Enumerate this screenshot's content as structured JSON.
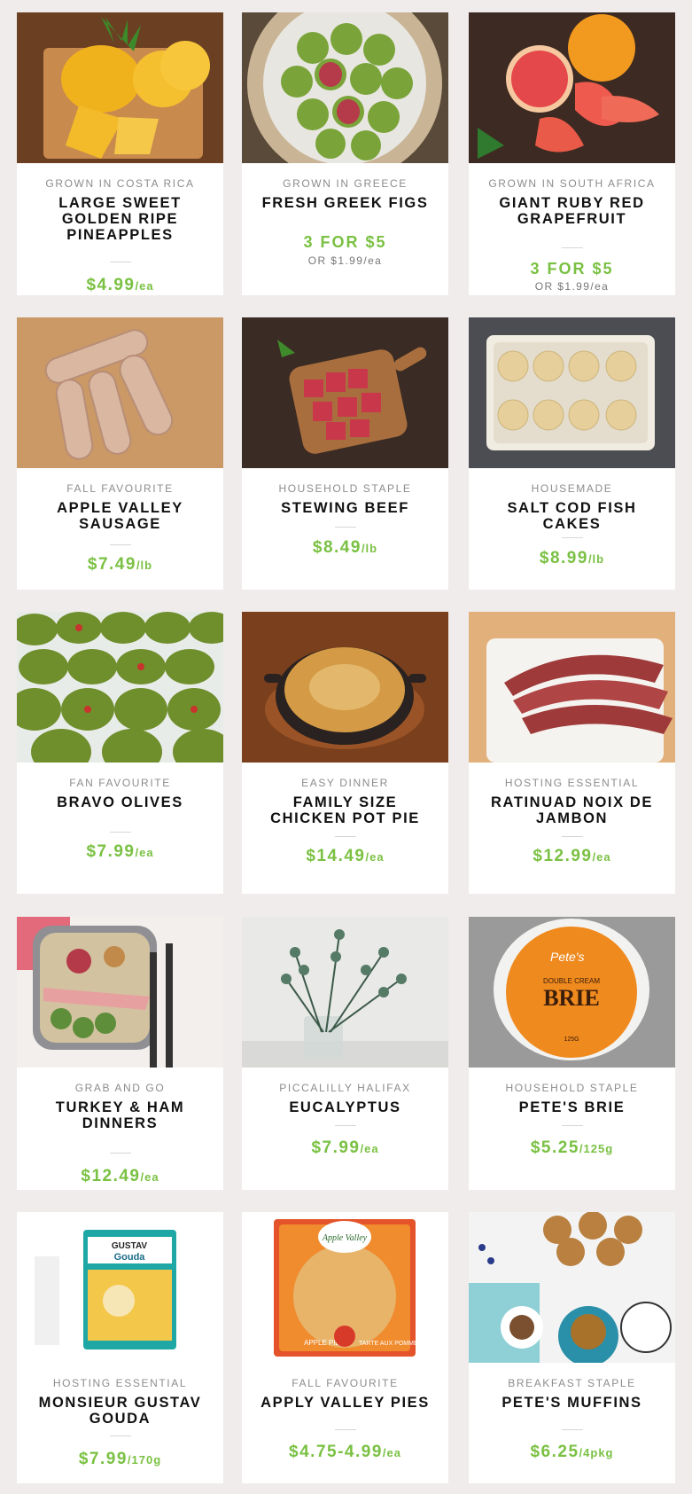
{
  "products": [
    {
      "origin": "GROWN IN COSTA RICA",
      "title": "LARGE SWEET GOLDEN RIPE PINEAPPLES",
      "price": "$4.99",
      "unit": "/ea",
      "image": "pineapple-image"
    },
    {
      "origin": "GROWN IN GREECE",
      "title": "FRESH GREEK FIGS",
      "deal": "3 FOR $5",
      "alt_price": "OR $1.99/ea",
      "image": "figs-image"
    },
    {
      "origin": "GROWN IN SOUTH AFRICA",
      "title": "GIANT RUBY RED GRAPEFRUIT",
      "deal": "3 FOR $5",
      "alt_price": "OR $1.99/ea",
      "image": "grapefruit-image"
    },
    {
      "origin": "FALL FAVOURITE",
      "title": "APPLE VALLEY SAUSAGE",
      "price": "$7.49",
      "unit": "/lb",
      "image": "sausage-image"
    },
    {
      "origin": "HOUSEHOLD STAPLE",
      "title": "STEWING BEEF",
      "price": "$8.49",
      "unit": "/lb",
      "image": "beef-image"
    },
    {
      "origin": "HOUSEMADE",
      "title": "SALT COD FISH CAKES",
      "price": "$8.99",
      "unit": "/lb",
      "image": "fishcakes-image"
    },
    {
      "origin": "FAN FAVOURITE",
      "title": "BRAVO OLIVES",
      "price": "$7.99",
      "unit": "/ea",
      "image": "olives-image"
    },
    {
      "origin": "EASY DINNER",
      "title": "FAMILY SIZE CHICKEN POT PIE",
      "price": "$14.49",
      "unit": "/ea",
      "image": "potpie-image"
    },
    {
      "origin": "HOSTING ESSENTIAL",
      "title": "RATINUAD NOIX DE JAMBON",
      "price": "$12.99",
      "unit": "/ea",
      "image": "jambon-image"
    },
    {
      "origin": "GRAB AND GO",
      "title": "TURKEY & HAM DINNERS",
      "price": "$12.49",
      "unit": "/ea",
      "image": "dinner-image"
    },
    {
      "origin": "PICCALILLY HALIFAX",
      "title": "EUCALYPTUS",
      "price": "$7.99",
      "unit": "/ea",
      "image": "eucalyptus-image"
    },
    {
      "origin": "HOUSEHOLD STAPLE",
      "title": "PETE'S BRIE",
      "price": "$5.25",
      "unit": "/125g",
      "image": "brie-image"
    },
    {
      "origin": "HOSTING ESSENTIAL",
      "title": "MONSIEUR GUSTAV GOUDA",
      "price": "$7.99",
      "unit": "/170g",
      "image": "gouda-image"
    },
    {
      "origin": "FALL FAVOURITE",
      "title": "APPLY VALLEY PIES",
      "price": "$4.75-4.99",
      "unit": "/ea",
      "image": "pies-image"
    },
    {
      "origin": "BREAKFAST STAPLE",
      "title": "PETE'S MUFFINS",
      "price": "$6.25",
      "unit": "/4pkg",
      "image": "muffins-image"
    }
  ],
  "brie_label": {
    "brand": "Pete's",
    "line1": "DOUBLE CREAM",
    "line2": "BRIE",
    "weight": "125G"
  },
  "gouda_label": {
    "brand": "GUSTAV",
    "name": "Gouda"
  },
  "pie_label": {
    "brand": "Apple Valley",
    "name": "APPLE PIE",
    "name_fr": "TARTE AUX POMMES"
  }
}
